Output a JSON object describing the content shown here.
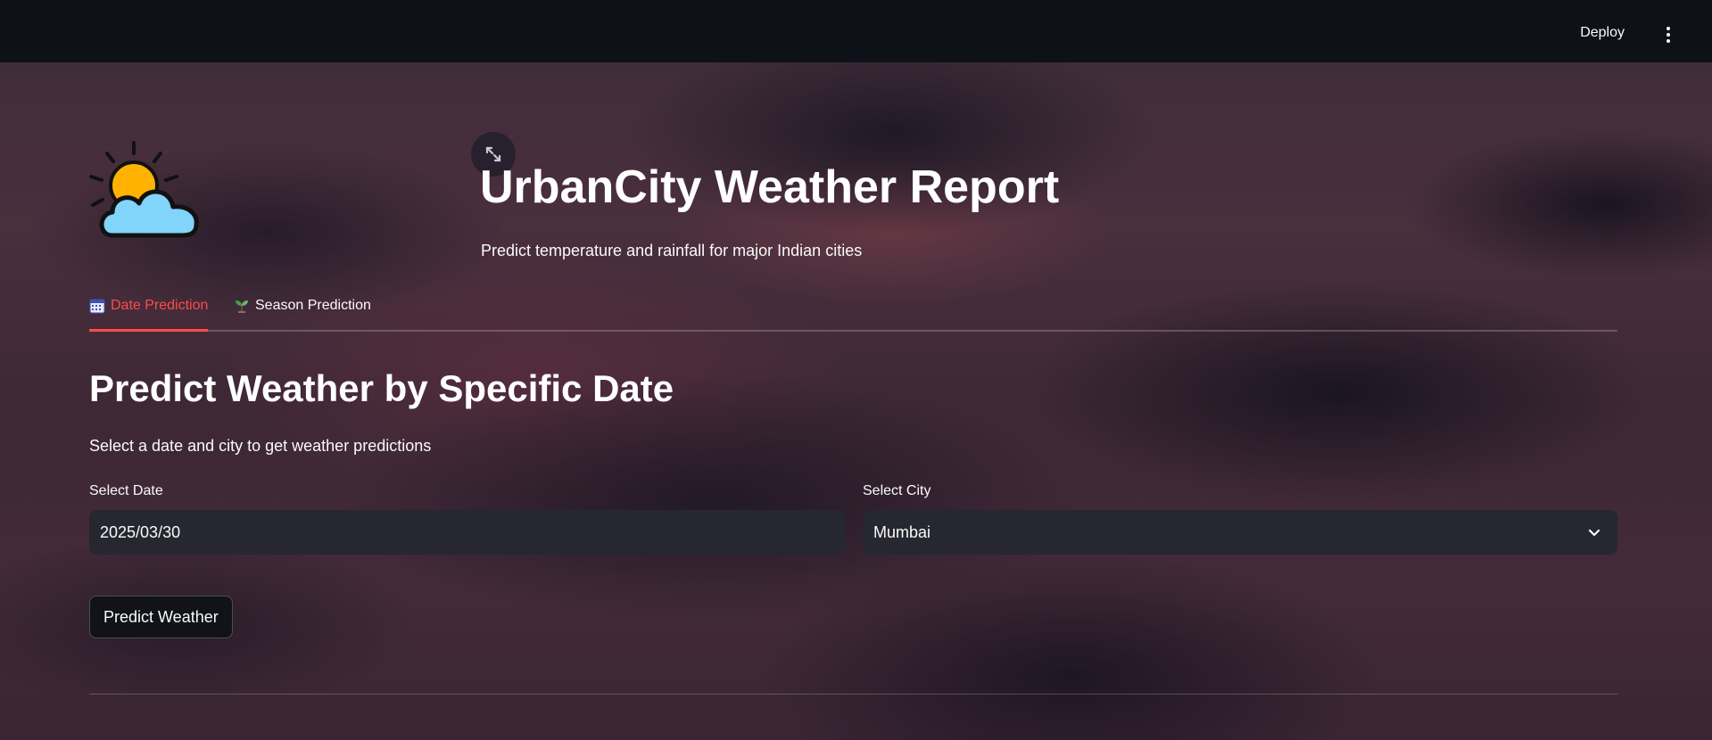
{
  "header": {
    "deploy_label": "Deploy",
    "menu_icon": "kebab-menu-icon"
  },
  "hero": {
    "logo_icon": "sun-behind-cloud-icon",
    "title": "UrbanCity Weather Report",
    "subtitle": "Predict temperature and rainfall for major Indian cities"
  },
  "tabs": [
    {
      "icon": "calendar-icon",
      "label": "Date Prediction",
      "active": true
    },
    {
      "icon": "seedling-icon",
      "label": "Season Prediction",
      "active": false
    }
  ],
  "date_prediction": {
    "heading": "Predict Weather by Specific Date",
    "description": "Select a date and city to get weather predictions",
    "date_field": {
      "label": "Select Date",
      "value": "2025/03/30"
    },
    "city_field": {
      "label": "Select City",
      "value": "Mumbai"
    },
    "submit_label": "Predict Weather"
  },
  "colors": {
    "accent": "#ff4b4b",
    "topbar": "#0e1117",
    "input_bg": "#262730",
    "text": "#fafafa"
  }
}
